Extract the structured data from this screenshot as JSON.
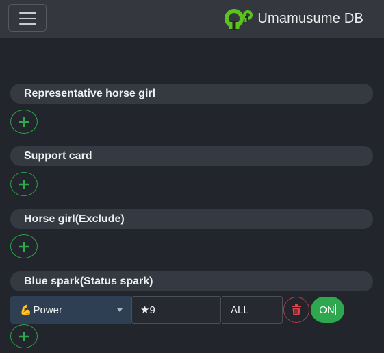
{
  "navbar": {
    "menu_icon": "hamburger-menu-icon",
    "brand_icon": "uma-logo-icon",
    "brand_title": "Umamusume DB",
    "brand_color": "#5cc21f"
  },
  "sections": [
    {
      "title": "Representative horse girl",
      "add_icon": "plus-icon"
    },
    {
      "title": "Support card",
      "add_icon": "plus-icon"
    },
    {
      "title": "Horse girl(Exclude)",
      "add_icon": "plus-icon"
    },
    {
      "title": "Blue spark(Status spark)",
      "add_icon": "plus-icon"
    }
  ],
  "blue_spark_row": {
    "status_emoji": "💪",
    "status_value": "Power",
    "stars_value": "★9",
    "target_value": "ALL",
    "delete_icon": "trash-icon",
    "toggle_label": "ON"
  },
  "colors": {
    "accent_green": "#2ea84e",
    "danger_red": "#b83a44",
    "background": "#22252b"
  }
}
